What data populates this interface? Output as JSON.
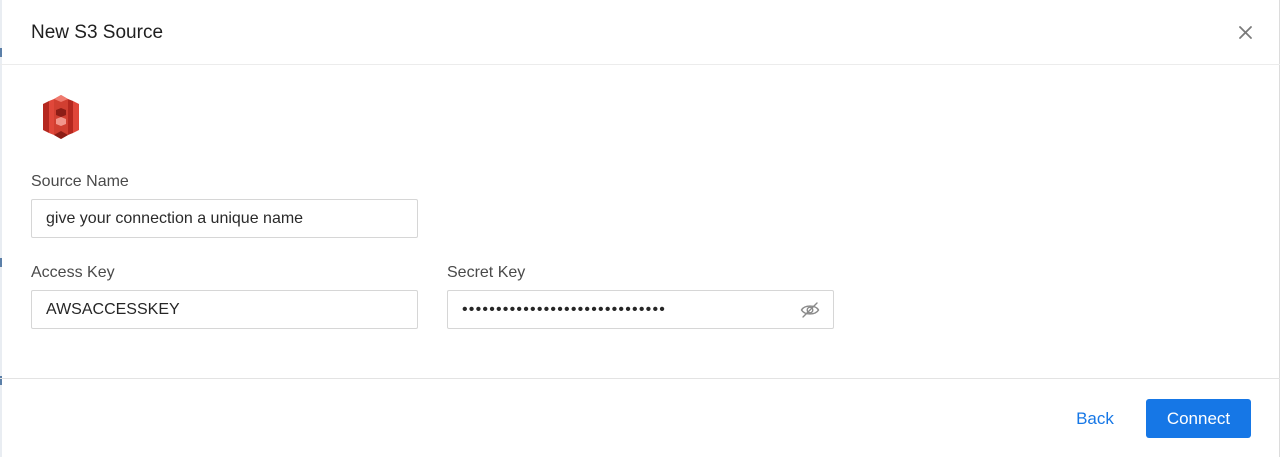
{
  "dialog": {
    "title": "New S3 Source",
    "close_icon": "close-icon",
    "logo_icon": "aws-s3-logo-icon"
  },
  "form": {
    "source_name": {
      "label": "Source Name",
      "value": "",
      "placeholder": "give your connection a unique name"
    },
    "access_key": {
      "label": "Access Key",
      "value": "AWSACCESSKEY"
    },
    "secret_key": {
      "label": "Secret Key",
      "masked_value": "••••••••••••••••••••••••••••••",
      "visibility_icon": "eye-hidden-icon"
    }
  },
  "footer": {
    "back_label": "Back",
    "connect_label": "Connect"
  },
  "colors": {
    "primary": "#1677e6",
    "logo_red": "#d13f31"
  }
}
